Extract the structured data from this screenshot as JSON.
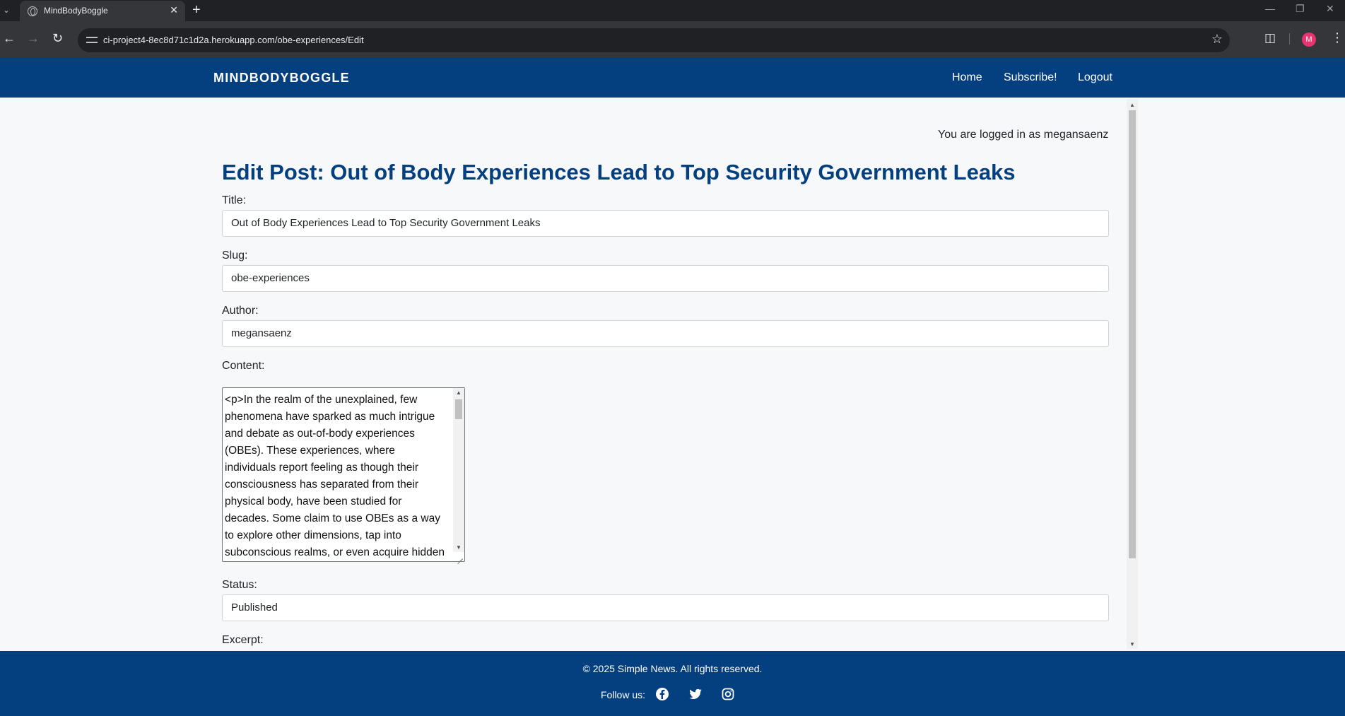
{
  "browser": {
    "tab_title": "MindBodyBoggle",
    "url": "ci-project4-8ec8d71c1d2a.herokuapp.com/obe-experiences/Edit",
    "avatar_letter": "M"
  },
  "navbar": {
    "brand": "MINDBODYBOGGLE",
    "links": [
      "Home",
      "Subscribe!",
      "Logout"
    ]
  },
  "main": {
    "logged_in_text": "You are logged in as megansaenz",
    "page_title": "Edit Post: Out of Body Experiences Lead to Top Security Government Leaks",
    "form": {
      "title_label": "Title:",
      "title_value": "Out of Body Experiences Lead to Top Security Government Leaks",
      "slug_label": "Slug:",
      "slug_value": "obe-experiences",
      "author_label": "Author:",
      "author_value": "megansaenz",
      "content_label": "Content:",
      "content_value": "<p>In the realm of the unexplained, few phenomena have sparked as much intrigue and debate as out-of-body experiences (OBEs). These experiences, where individuals report feeling as though their consciousness has separated from their physical body, have been studied for decades. Some claim to use OBEs as a way to explore other dimensions, tap into subconscious realms, or even acquire hidden knowledge&mdash;leading to",
      "status_label": "Status:",
      "status_value": "Published",
      "excerpt_label": "Excerpt:"
    }
  },
  "footer": {
    "copyright": "© 2025 Simple News. All rights reserved.",
    "follow_label": "Follow us:"
  },
  "colors": {
    "brand_blue": "#043f80",
    "page_bg": "#f7f8fa"
  }
}
